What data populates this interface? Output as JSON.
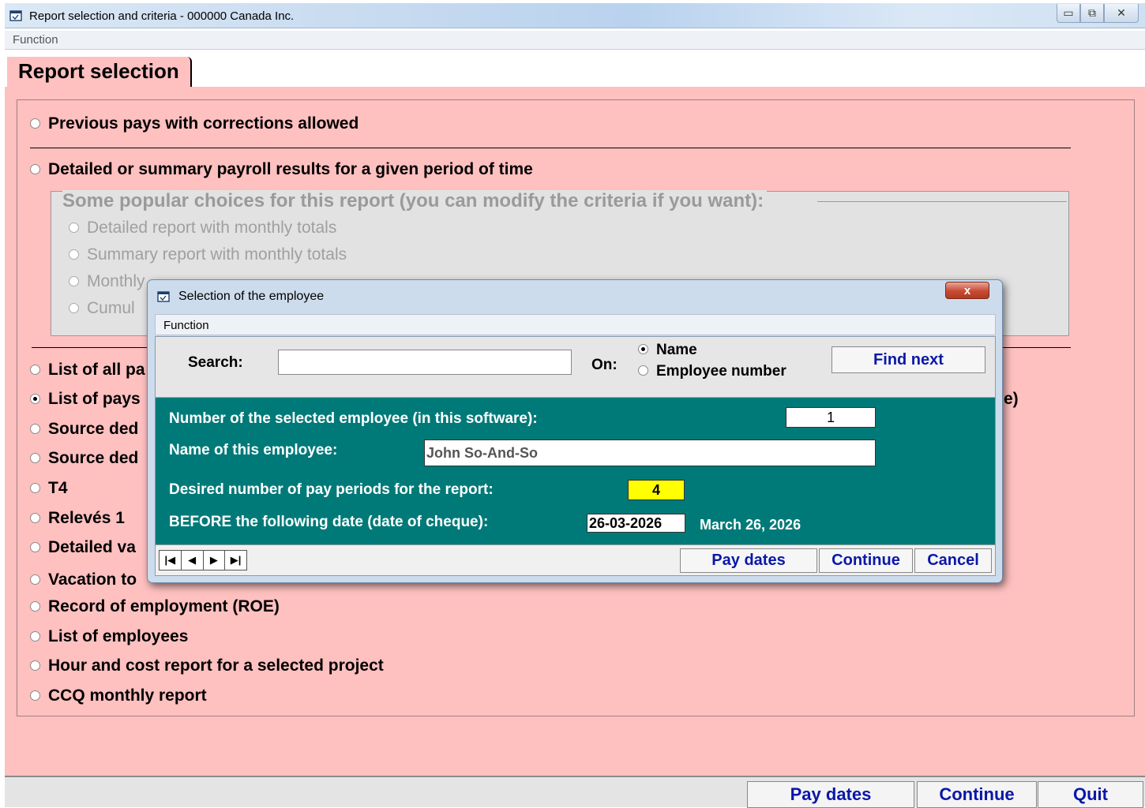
{
  "window": {
    "title": "Report selection and criteria - 000000 Canada Inc.",
    "minimize": "▭",
    "maximize": "⧉",
    "close": "✕"
  },
  "menu": {
    "function": "Function"
  },
  "tab": {
    "label": "Report selection"
  },
  "options": [
    {
      "label": "Previous pays with corrections allowed",
      "selected": false
    },
    {
      "label": "Detailed or summary payroll results for a given period of time",
      "selected": false
    },
    {
      "label": "List of all pa",
      "selected": false
    },
    {
      "label": "List of pays",
      "selected": true,
      "suffix": "e)"
    },
    {
      "label": "Source ded",
      "selected": false
    },
    {
      "label": "Source ded",
      "selected": false
    },
    {
      "label": "T4",
      "selected": false
    },
    {
      "label": "Relevés 1",
      "selected": false
    },
    {
      "label": "Detailed va",
      "selected": false
    },
    {
      "label": "Vacation to",
      "selected": false
    },
    {
      "label": "Record of employment (ROE)",
      "selected": false
    },
    {
      "label": "List of employees",
      "selected": false
    },
    {
      "label": "Hour and cost report for a selected project",
      "selected": false
    },
    {
      "label": "CCQ monthly report",
      "selected": false
    }
  ],
  "popular_group": {
    "legend": "Some popular choices for this report (you can modify the criteria if you want):",
    "items": [
      "Detailed report with monthly totals",
      "Summary report with monthly totals",
      "Monthly",
      "Cumul"
    ]
  },
  "bottom_buttons": {
    "pay_dates": "Pay dates",
    "continue": "Continue",
    "quit": "Quit"
  },
  "dialog": {
    "title": "Selection of the employee",
    "close": "x",
    "menu_function": "Function",
    "search_label": "Search:",
    "search_value": "",
    "on_label": "On:",
    "on_options": [
      {
        "label": "Name",
        "selected": true
      },
      {
        "label": "Employee number",
        "selected": false
      }
    ],
    "find_next": "Find next",
    "employee_number_label": "Number of the selected employee (in this software):",
    "employee_number_value": "1",
    "employee_name_label": "Name of this employee:",
    "employee_name_value": "John So-And-So",
    "periods_label": "Desired number of pay periods for the report:",
    "periods_value": "4",
    "before_date_label": "BEFORE the following date (date of cheque):",
    "before_date_value": "26-03-2026",
    "before_date_text": "March 26, 2026",
    "nav": {
      "first": "|◀",
      "prev": "◀",
      "next": "▶",
      "last": "▶|"
    },
    "pay_dates": "Pay dates",
    "continue": "Continue",
    "cancel": "Cancel"
  },
  "colors": {
    "background_pink": "#ffc0c0",
    "teal": "#007a78",
    "button_text": "#0a17a8",
    "highlight_yellow": "#ffff00"
  }
}
